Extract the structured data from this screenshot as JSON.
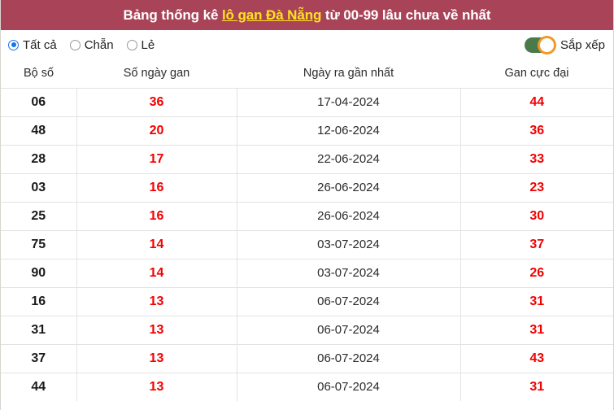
{
  "header": {
    "title_prefix": "Bảng thống kê ",
    "title_link": "lô gan Đà Nẵng",
    "title_suffix": " từ 00-99 lâu chưa về nhất",
    "background_color": "#a94458",
    "link_color": "#ffe21f"
  },
  "controls": {
    "radios": [
      {
        "label": "Tất cả",
        "selected": true
      },
      {
        "label": "Chẵn",
        "selected": false
      },
      {
        "label": "Lẻ",
        "selected": false
      }
    ],
    "sort": {
      "label": "Sắp xếp",
      "enabled": true,
      "track_color": "#4a7a4a",
      "knob_ring_color": "#f0982a"
    }
  },
  "table": {
    "columns": [
      "Bộ số",
      "Số ngày gan",
      "Ngày ra gần nhất",
      "Gan cực đại"
    ],
    "rows": [
      {
        "bo_so": "06",
        "so_ngay_gan": "36",
        "ngay_ra_gan_nhat": "17-04-2024",
        "gan_cuc_dai": "44"
      },
      {
        "bo_so": "48",
        "so_ngay_gan": "20",
        "ngay_ra_gan_nhat": "12-06-2024",
        "gan_cuc_dai": "36"
      },
      {
        "bo_so": "28",
        "so_ngay_gan": "17",
        "ngay_ra_gan_nhat": "22-06-2024",
        "gan_cuc_dai": "33"
      },
      {
        "bo_so": "03",
        "so_ngay_gan": "16",
        "ngay_ra_gan_nhat": "26-06-2024",
        "gan_cuc_dai": "23"
      },
      {
        "bo_so": "25",
        "so_ngay_gan": "16",
        "ngay_ra_gan_nhat": "26-06-2024",
        "gan_cuc_dai": "30"
      },
      {
        "bo_so": "75",
        "so_ngay_gan": "14",
        "ngay_ra_gan_nhat": "03-07-2024",
        "gan_cuc_dai": "37"
      },
      {
        "bo_so": "90",
        "so_ngay_gan": "14",
        "ngay_ra_gan_nhat": "03-07-2024",
        "gan_cuc_dai": "26"
      },
      {
        "bo_so": "16",
        "so_ngay_gan": "13",
        "ngay_ra_gan_nhat": "06-07-2024",
        "gan_cuc_dai": "31"
      },
      {
        "bo_so": "31",
        "so_ngay_gan": "13",
        "ngay_ra_gan_nhat": "06-07-2024",
        "gan_cuc_dai": "31"
      },
      {
        "bo_so": "37",
        "so_ngay_gan": "13",
        "ngay_ra_gan_nhat": "06-07-2024",
        "gan_cuc_dai": "43"
      },
      {
        "bo_so": "44",
        "so_ngay_gan": "13",
        "ngay_ra_gan_nhat": "06-07-2024",
        "gan_cuc_dai": "31"
      }
    ],
    "value_color": "#f20000"
  }
}
